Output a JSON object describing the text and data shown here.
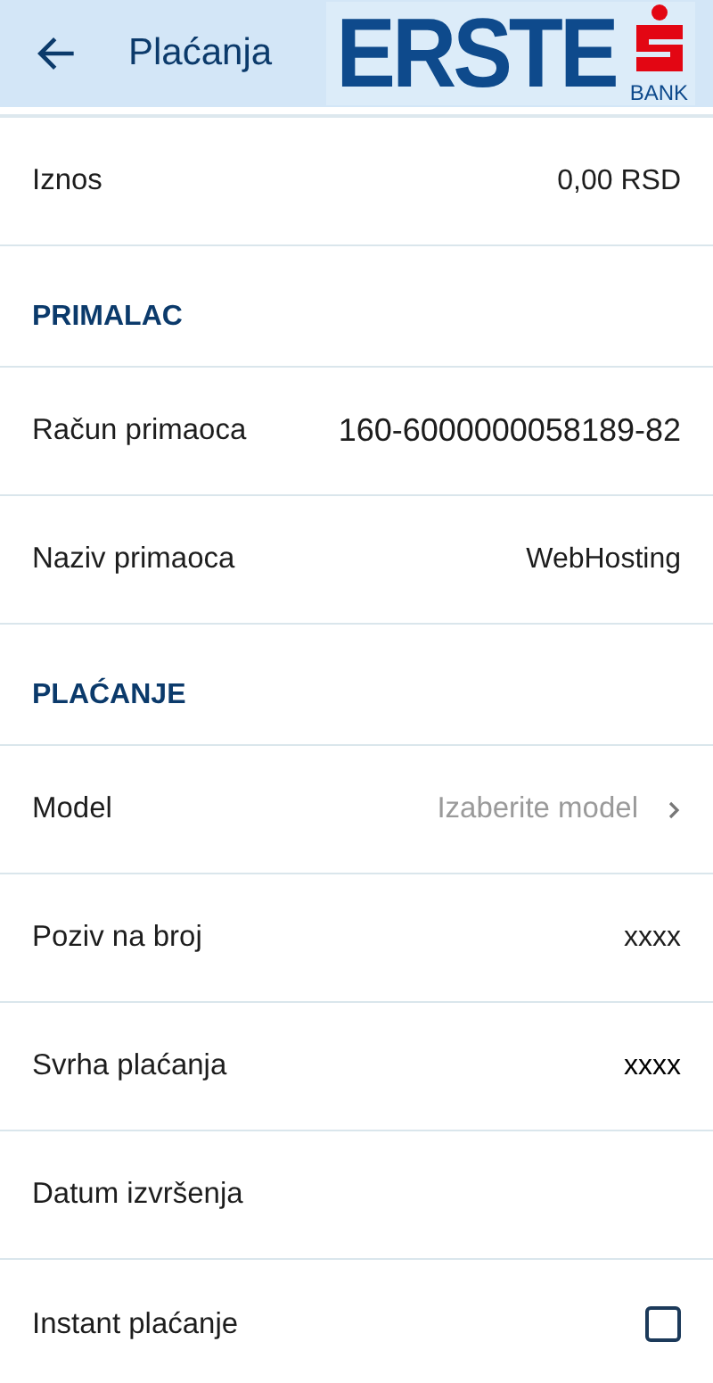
{
  "header": {
    "title": "Plaćanja",
    "logo_text": "ERSTE",
    "logo_subtext": "BANK"
  },
  "sections": [
    {
      "rows": [
        {
          "kind": "value",
          "label": "Iznos",
          "value": "0,00 RSD"
        }
      ]
    },
    {
      "heading": "PRIMALAC",
      "rows": [
        {
          "kind": "value",
          "label": "Račun primaoca",
          "value": "160-6000000058189-82"
        },
        {
          "kind": "value",
          "label": "Naziv primaoca",
          "value": "WebHosting"
        }
      ]
    },
    {
      "heading": "PLAĆANJE",
      "rows": [
        {
          "kind": "select",
          "label": "Model",
          "placeholder": "Izaberite model"
        },
        {
          "kind": "value",
          "label": "Poziv na broj",
          "value": "xxxx"
        },
        {
          "kind": "input",
          "label": "Svrha plaćanja",
          "value": "xxxx"
        },
        {
          "kind": "value",
          "label": "Datum izvršenja"
        },
        {
          "kind": "checkbox",
          "label": "Instant plaćanje",
          "checked": false
        }
      ]
    }
  ]
}
